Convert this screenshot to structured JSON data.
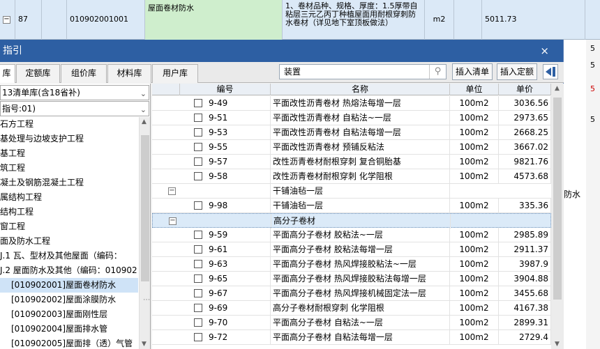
{
  "background_row": {
    "row_no": "87",
    "code": "010902001001",
    "name": "屋面卷材防水",
    "desc": "1、卷材品种、规格、厚度：1.5厚带自粘层三元乙丙丁种植屋面用耐根穿刺防水卷材（详见地下室顶板做法）",
    "unit": "m2",
    "qty": "5011.73"
  },
  "background_right": [
    "5",
    "5",
    "5",
    "5"
  ],
  "background_partial": "防水",
  "dialog": {
    "title": "指引",
    "close": "×",
    "tabs": [
      "库",
      "定额库",
      "组价库",
      "材料库",
      "用户库"
    ],
    "search_value": "装置",
    "buttons": {
      "insert_list": "插入清单",
      "insert_quota": "插入定额"
    }
  },
  "left": {
    "combo1": "13清单库(含18省补)",
    "combo2": "指号:01)",
    "tree": [
      "石方工程",
      "基处理与边坡支护工程",
      "基工程",
      "筑工程",
      "凝土及钢筋混凝土工程",
      "属结构工程",
      "结构工程",
      "窗工程",
      "面及防水工程",
      "J.1 瓦、型材及其他屋面（编码：",
      "J.2 屋面防水及其他（编码：010902",
      "[010902001]屋面卷材防水",
      "[010902002]屋面涂膜防水",
      "[010902003]屋面刚性层",
      "[010902004]屋面排水管",
      "[010902005]屋面排（透）气管"
    ]
  },
  "table": {
    "headers": {
      "code": "编号",
      "name": "名称",
      "unit": "单位",
      "price": "单价"
    },
    "rows": [
      {
        "type": "item",
        "code": "9-49",
        "name": "平面改性沥青卷材 热熔法每增一层",
        "unit": "100m2",
        "price": "3036.56"
      },
      {
        "type": "item",
        "code": "9-51",
        "name": "平面改性沥青卷材 自粘法~一层",
        "unit": "100m2",
        "price": "2973.65"
      },
      {
        "type": "item",
        "code": "9-53",
        "name": "平面改性沥青卷材 自粘法每增一层",
        "unit": "100m2",
        "price": "2668.25"
      },
      {
        "type": "item",
        "code": "9-55",
        "name": "平面改性沥青卷材 预铺反粘法",
        "unit": "100m2",
        "price": "3667.02"
      },
      {
        "type": "item",
        "code": "9-57",
        "name": "改性沥青卷材耐根穿刺 复合铜胎基",
        "unit": "100m2",
        "price": "9821.76"
      },
      {
        "type": "item",
        "code": "9-58",
        "name": "改性沥青卷材耐根穿刺 化学阻根",
        "unit": "100m2",
        "price": "4573.68"
      },
      {
        "type": "group",
        "name": "干铺油毡一层"
      },
      {
        "type": "item",
        "code": "9-98",
        "name": "干铺油毡一层",
        "unit": "100m2",
        "price": "335.36"
      },
      {
        "type": "group",
        "name": "高分子卷材",
        "selected": true
      },
      {
        "type": "item",
        "code": "9-59",
        "name": "平面高分子卷材 胶粘法~一层",
        "unit": "100m2",
        "price": "2985.89"
      },
      {
        "type": "item",
        "code": "9-61",
        "name": "平面高分子卷材 胶粘法每增一层",
        "unit": "100m2",
        "price": "2911.37"
      },
      {
        "type": "item",
        "code": "9-63",
        "name": "平面高分子卷材 热风焊接胶粘法~一层",
        "unit": "100m2",
        "price": "3987.9"
      },
      {
        "type": "item",
        "code": "9-65",
        "name": "平面高分子卷材 热风焊接胶粘法每增一层",
        "unit": "100m2",
        "price": "3904.88"
      },
      {
        "type": "item",
        "code": "9-67",
        "name": "平面高分子卷材 热风焊接机械固定法一层",
        "unit": "100m2",
        "price": "3455.68"
      },
      {
        "type": "item",
        "code": "9-69",
        "name": "高分子卷材耐根穿刺 化学阻根",
        "unit": "100m2",
        "price": "4167.38"
      },
      {
        "type": "item",
        "code": "9-70",
        "name": "平面高分子卷材 自粘法~一层",
        "unit": "100m2",
        "price": "2899.31"
      },
      {
        "type": "item",
        "code": "9-72",
        "name": "平面高分子卷材 自粘法每增一层",
        "unit": "100m2",
        "price": "2729.4"
      }
    ]
  }
}
